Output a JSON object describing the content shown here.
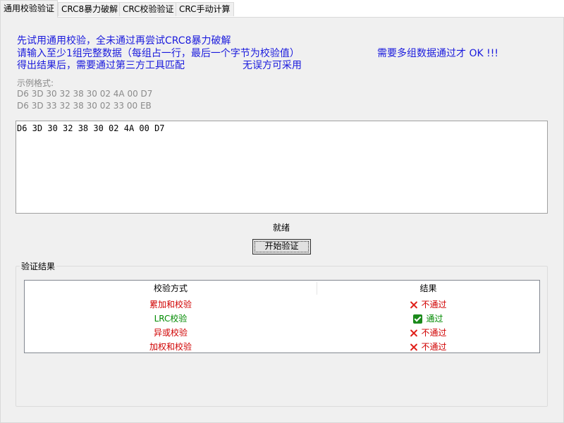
{
  "tabs": [
    {
      "label": "通用校验验证",
      "active": true
    },
    {
      "label": "CRC8暴力破解",
      "active": false
    },
    {
      "label": "CRC校验验证",
      "active": false
    },
    {
      "label": "CRC手动计算",
      "active": false
    }
  ],
  "instructions": {
    "line1": "先试用通用校验，全未通过再尝试CRC8暴力破解",
    "line2": "请输入至少1组完整数据（每组占一行，最后一个字节为校验值）",
    "line2_right": "需要多组数据通过才 OK !!!",
    "line3": "得出结果后，需要通过第三方工具匹配",
    "line3_right": "无误方可采用"
  },
  "example": {
    "label": "示例格式:",
    "line1": "D6 3D 30 32 38 30 02 4A 00 D7",
    "line2": "D6 3D 33 32 38 30 02 33 00 EB"
  },
  "input": {
    "value": "D6 3D 30 32 38 30 02 4A 00 D7"
  },
  "status": "就绪",
  "start_button": "开始验证",
  "results": {
    "group_label": "验证结果",
    "columns": [
      "校验方式",
      "结果"
    ],
    "rows": [
      {
        "method": "累加和校验",
        "result": "不通过",
        "passed": false
      },
      {
        "method": "LRC校验",
        "result": "通过",
        "passed": true
      },
      {
        "method": "异或校验",
        "result": "不通过",
        "passed": false
      },
      {
        "method": "加权和校验",
        "result": "不通过",
        "passed": false
      }
    ]
  },
  "colors": {
    "instruction_text": "#1a1add",
    "fail": "#d00000",
    "pass": "#008a00"
  }
}
